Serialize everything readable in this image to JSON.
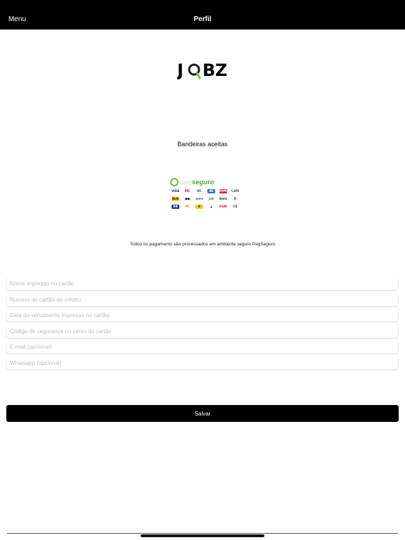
{
  "nav": {
    "menu_label": "Menu",
    "title": "Perfil"
  },
  "logo": {
    "text": "JOBZ",
    "letters": [
      "J",
      "B",
      "Z"
    ],
    "icon": "magnifier-o-icon",
    "color": "#7dbb3a"
  },
  "brands_section": {
    "title": "Bandeiras aceitas"
  },
  "pagseguro": {
    "word_pag": "pag",
    "word_seguro": "seguro",
    "brand_color": "#4caf25",
    "cards": [
      {
        "label": "VISA",
        "bg": "#ffffff",
        "fg": "#1a1f71"
      },
      {
        "label": "MC",
        "bg": "#ffffff",
        "fg": "#eb001b"
      },
      {
        "label": "DC",
        "bg": "#ffffff",
        "fg": "#004a97"
      },
      {
        "label": "AE",
        "bg": "#2e77bb",
        "fg": "#ffffff"
      },
      {
        "label": "HIPER",
        "bg": "#d9252a",
        "fg": "#ffffff"
      },
      {
        "label": "CARD",
        "bg": "#ffffff",
        "fg": "#555555"
      },
      {
        "label": "ELO",
        "bg": "#ffc629",
        "fg": "#000000"
      },
      {
        "label": "●●",
        "bg": "#ffffff",
        "fg": "#111111"
      },
      {
        "label": "aura",
        "bg": "#ffffff",
        "fg": "#1b5aa8"
      },
      {
        "label": "jcb",
        "bg": "#ffffff",
        "fg": "#0b7a3d"
      },
      {
        "label": "Sorocred",
        "bg": "#ffffff",
        "fg": "#111111"
      },
      {
        "label": "B",
        "bg": "#ffffff",
        "fg": "#d9252a"
      },
      {
        "label": "BB",
        "bg": "#1b3a8a",
        "fg": "#ffffff"
      },
      {
        "label": "HC",
        "bg": "#ffffff",
        "fg": "#e67e22"
      },
      {
        "label": "B",
        "bg": "#f5d200",
        "fg": "#1b3a8a"
      },
      {
        "label": "▲",
        "bg": "#ffffff",
        "fg": "#1b5aa8"
      },
      {
        "label": "HSBC",
        "bg": "#ffffff",
        "fg": "#d9252a"
      },
      {
        "label": "CS",
        "bg": "#ffffff",
        "fg": "#333333"
      }
    ]
  },
  "secure_note": "Todos os pagamento são processados em ambiente seguro PagSeguro",
  "form": {
    "name_placeholder": "Nome impresso no cartão",
    "number_placeholder": "Número do cartão de crédito",
    "expiry_placeholder": "Data do vencimento impresso no cartão",
    "cvv_placeholder": "Código de segurança no verso do cartão",
    "email_placeholder": "E-mail (opcional)",
    "whatsapp_placeholder": "Whatsapp (opcional)"
  },
  "save_label": "Salvar"
}
